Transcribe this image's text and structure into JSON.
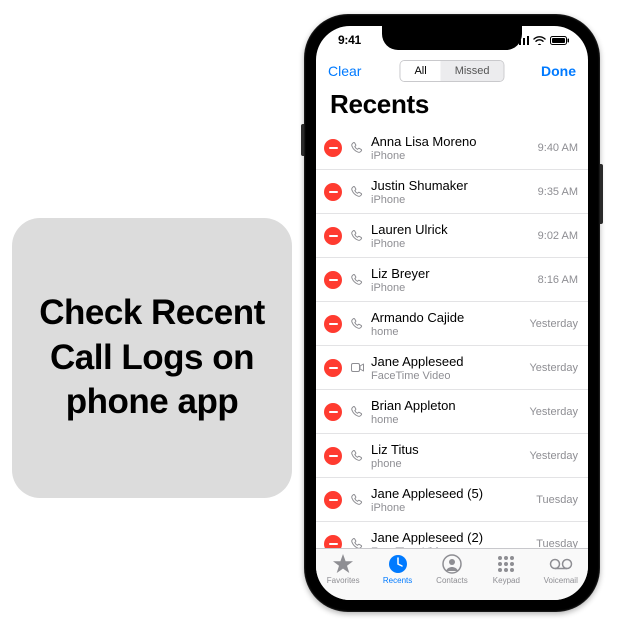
{
  "caption": "Check Recent Call Logs on phone app",
  "status": {
    "time": "9:41"
  },
  "nav": {
    "clear": "Clear",
    "done": "Done",
    "seg_all": "All",
    "seg_missed": "Missed"
  },
  "title": "Recents",
  "calls": [
    {
      "name": "Anna Lisa Moreno",
      "sub": "iPhone",
      "time": "9:40 AM",
      "icon": "phone"
    },
    {
      "name": "Justin Shumaker",
      "sub": "iPhone",
      "time": "9:35 AM",
      "icon": "phone"
    },
    {
      "name": "Lauren Ulrick",
      "sub": "iPhone",
      "time": "9:02 AM",
      "icon": "phone"
    },
    {
      "name": "Liz Breyer",
      "sub": "iPhone",
      "time": "8:16 AM",
      "icon": "phone"
    },
    {
      "name": "Armando Cajide",
      "sub": "home",
      "time": "Yesterday",
      "icon": "phone"
    },
    {
      "name": "Jane Appleseed",
      "sub": "FaceTime Video",
      "time": "Yesterday",
      "icon": "video"
    },
    {
      "name": "Brian Appleton",
      "sub": "home",
      "time": "Yesterday",
      "icon": "phone"
    },
    {
      "name": "Liz Titus",
      "sub": "phone",
      "time": "Yesterday",
      "icon": "phone"
    },
    {
      "name": "Jane Appleseed (5)",
      "sub": "iPhone",
      "time": "Tuesday",
      "icon": "phone"
    },
    {
      "name": "Jane Appleseed (2)",
      "sub": "FaceTime Video",
      "time": "Tuesday",
      "icon": "phone"
    }
  ],
  "tabs": {
    "favorites": "Favorites",
    "recents": "Recents",
    "contacts": "Contacts",
    "keypad": "Keypad",
    "voicemail": "Voicemail"
  }
}
